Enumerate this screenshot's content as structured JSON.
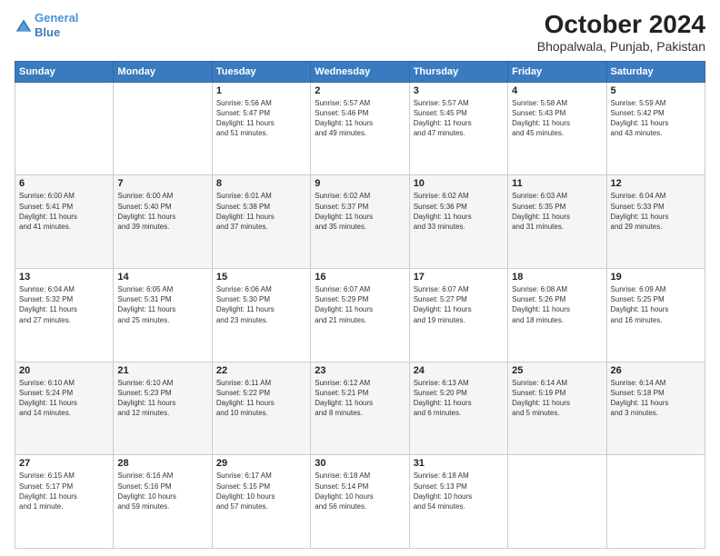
{
  "header": {
    "logo_line1": "General",
    "logo_line2": "Blue",
    "main_title": "October 2024",
    "sub_title": "Bhopalwala, Punjab, Pakistan"
  },
  "columns": [
    "Sunday",
    "Monday",
    "Tuesday",
    "Wednesday",
    "Thursday",
    "Friday",
    "Saturday"
  ],
  "weeks": [
    [
      {
        "day": "",
        "info": ""
      },
      {
        "day": "",
        "info": ""
      },
      {
        "day": "1",
        "info": "Sunrise: 5:56 AM\nSunset: 5:47 PM\nDaylight: 11 hours\nand 51 minutes."
      },
      {
        "day": "2",
        "info": "Sunrise: 5:57 AM\nSunset: 5:46 PM\nDaylight: 11 hours\nand 49 minutes."
      },
      {
        "day": "3",
        "info": "Sunrise: 5:57 AM\nSunset: 5:45 PM\nDaylight: 11 hours\nand 47 minutes."
      },
      {
        "day": "4",
        "info": "Sunrise: 5:58 AM\nSunset: 5:43 PM\nDaylight: 11 hours\nand 45 minutes."
      },
      {
        "day": "5",
        "info": "Sunrise: 5:59 AM\nSunset: 5:42 PM\nDaylight: 11 hours\nand 43 minutes."
      }
    ],
    [
      {
        "day": "6",
        "info": "Sunrise: 6:00 AM\nSunset: 5:41 PM\nDaylight: 11 hours\nand 41 minutes."
      },
      {
        "day": "7",
        "info": "Sunrise: 6:00 AM\nSunset: 5:40 PM\nDaylight: 11 hours\nand 39 minutes."
      },
      {
        "day": "8",
        "info": "Sunrise: 6:01 AM\nSunset: 5:38 PM\nDaylight: 11 hours\nand 37 minutes."
      },
      {
        "day": "9",
        "info": "Sunrise: 6:02 AM\nSunset: 5:37 PM\nDaylight: 11 hours\nand 35 minutes."
      },
      {
        "day": "10",
        "info": "Sunrise: 6:02 AM\nSunset: 5:36 PM\nDaylight: 11 hours\nand 33 minutes."
      },
      {
        "day": "11",
        "info": "Sunrise: 6:03 AM\nSunset: 5:35 PM\nDaylight: 11 hours\nand 31 minutes."
      },
      {
        "day": "12",
        "info": "Sunrise: 6:04 AM\nSunset: 5:33 PM\nDaylight: 11 hours\nand 29 minutes."
      }
    ],
    [
      {
        "day": "13",
        "info": "Sunrise: 6:04 AM\nSunset: 5:32 PM\nDaylight: 11 hours\nand 27 minutes."
      },
      {
        "day": "14",
        "info": "Sunrise: 6:05 AM\nSunset: 5:31 PM\nDaylight: 11 hours\nand 25 minutes."
      },
      {
        "day": "15",
        "info": "Sunrise: 6:06 AM\nSunset: 5:30 PM\nDaylight: 11 hours\nand 23 minutes."
      },
      {
        "day": "16",
        "info": "Sunrise: 6:07 AM\nSunset: 5:29 PM\nDaylight: 11 hours\nand 21 minutes."
      },
      {
        "day": "17",
        "info": "Sunrise: 6:07 AM\nSunset: 5:27 PM\nDaylight: 11 hours\nand 19 minutes."
      },
      {
        "day": "18",
        "info": "Sunrise: 6:08 AM\nSunset: 5:26 PM\nDaylight: 11 hours\nand 18 minutes."
      },
      {
        "day": "19",
        "info": "Sunrise: 6:09 AM\nSunset: 5:25 PM\nDaylight: 11 hours\nand 16 minutes."
      }
    ],
    [
      {
        "day": "20",
        "info": "Sunrise: 6:10 AM\nSunset: 5:24 PM\nDaylight: 11 hours\nand 14 minutes."
      },
      {
        "day": "21",
        "info": "Sunrise: 6:10 AM\nSunset: 5:23 PM\nDaylight: 11 hours\nand 12 minutes."
      },
      {
        "day": "22",
        "info": "Sunrise: 6:11 AM\nSunset: 5:22 PM\nDaylight: 11 hours\nand 10 minutes."
      },
      {
        "day": "23",
        "info": "Sunrise: 6:12 AM\nSunset: 5:21 PM\nDaylight: 11 hours\nand 8 minutes."
      },
      {
        "day": "24",
        "info": "Sunrise: 6:13 AM\nSunset: 5:20 PM\nDaylight: 11 hours\nand 6 minutes."
      },
      {
        "day": "25",
        "info": "Sunrise: 6:14 AM\nSunset: 5:19 PM\nDaylight: 11 hours\nand 5 minutes."
      },
      {
        "day": "26",
        "info": "Sunrise: 6:14 AM\nSunset: 5:18 PM\nDaylight: 11 hours\nand 3 minutes."
      }
    ],
    [
      {
        "day": "27",
        "info": "Sunrise: 6:15 AM\nSunset: 5:17 PM\nDaylight: 11 hours\nand 1 minute."
      },
      {
        "day": "28",
        "info": "Sunrise: 6:16 AM\nSunset: 5:16 PM\nDaylight: 10 hours\nand 59 minutes."
      },
      {
        "day": "29",
        "info": "Sunrise: 6:17 AM\nSunset: 5:15 PM\nDaylight: 10 hours\nand 57 minutes."
      },
      {
        "day": "30",
        "info": "Sunrise: 6:18 AM\nSunset: 5:14 PM\nDaylight: 10 hours\nand 56 minutes."
      },
      {
        "day": "31",
        "info": "Sunrise: 6:18 AM\nSunset: 5:13 PM\nDaylight: 10 hours\nand 54 minutes."
      },
      {
        "day": "",
        "info": ""
      },
      {
        "day": "",
        "info": ""
      }
    ]
  ]
}
